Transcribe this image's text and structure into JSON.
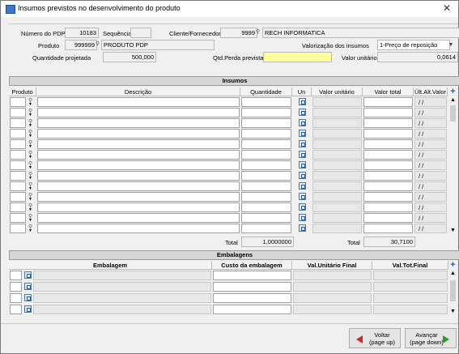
{
  "window": {
    "title": "Insumos previstos no desenvolvimento do produto",
    "close_glyph": "✕"
  },
  "header": {
    "pdp_label": "Número do PDP",
    "pdp_value": "10183",
    "sequencia_label": "Sequência",
    "sequencia_value": "",
    "cliente_label": "Cliente/Fornecedor",
    "cliente_code": "9999",
    "cliente_name": "RECH INFORMATICA",
    "produto_label": "Produto",
    "produto_code": "999999",
    "produto_name": "PRODUTO PDP",
    "valorizacao_label": "Valorização dos insumos",
    "valorizacao_value": "1-Preço de reposição",
    "qtd_label": "Quantidade projetada",
    "qtd_value": "500,000",
    "perda_label": "Qtd.Perda prevista",
    "perda_value": "",
    "valor_unit_label": "Valor unitário",
    "valor_unit_value": "0,0614"
  },
  "insumos": {
    "section_title": "Insumos",
    "columns": [
      "Produto",
      "Descrição",
      "Quantidade",
      "Un",
      "Valor unitário",
      "Valor total",
      "Últ.Alt.Valor"
    ],
    "row_count": 13,
    "last_alt_placeholder": "/ /",
    "total_label_1": "Total",
    "total_qty": "1,0000000",
    "total_label_2": "Total",
    "total_value": "30,7100"
  },
  "embalagens": {
    "section_title": "Embalagens",
    "columns": [
      "Embalagem",
      "Custo da embalagem",
      "Val.Unitário Final",
      "Val.Tot.Final"
    ],
    "row_count": 4
  },
  "footer": {
    "back_label_1": "Voltar",
    "back_label_2": "(page up)",
    "next_label_1": "Avançar",
    "next_label_2": "(page down)"
  },
  "icons": {
    "close": "close-icon",
    "search": "search-icon",
    "add": "plus-icon",
    "back": "arrow-left-icon",
    "next": "arrow-right-icon"
  },
  "colors": {
    "yellow_field": "#ffff99",
    "add_icon": "#1d5fb8",
    "back_arrow": "#c62b2b",
    "next_arrow": "#2f9a2f"
  }
}
